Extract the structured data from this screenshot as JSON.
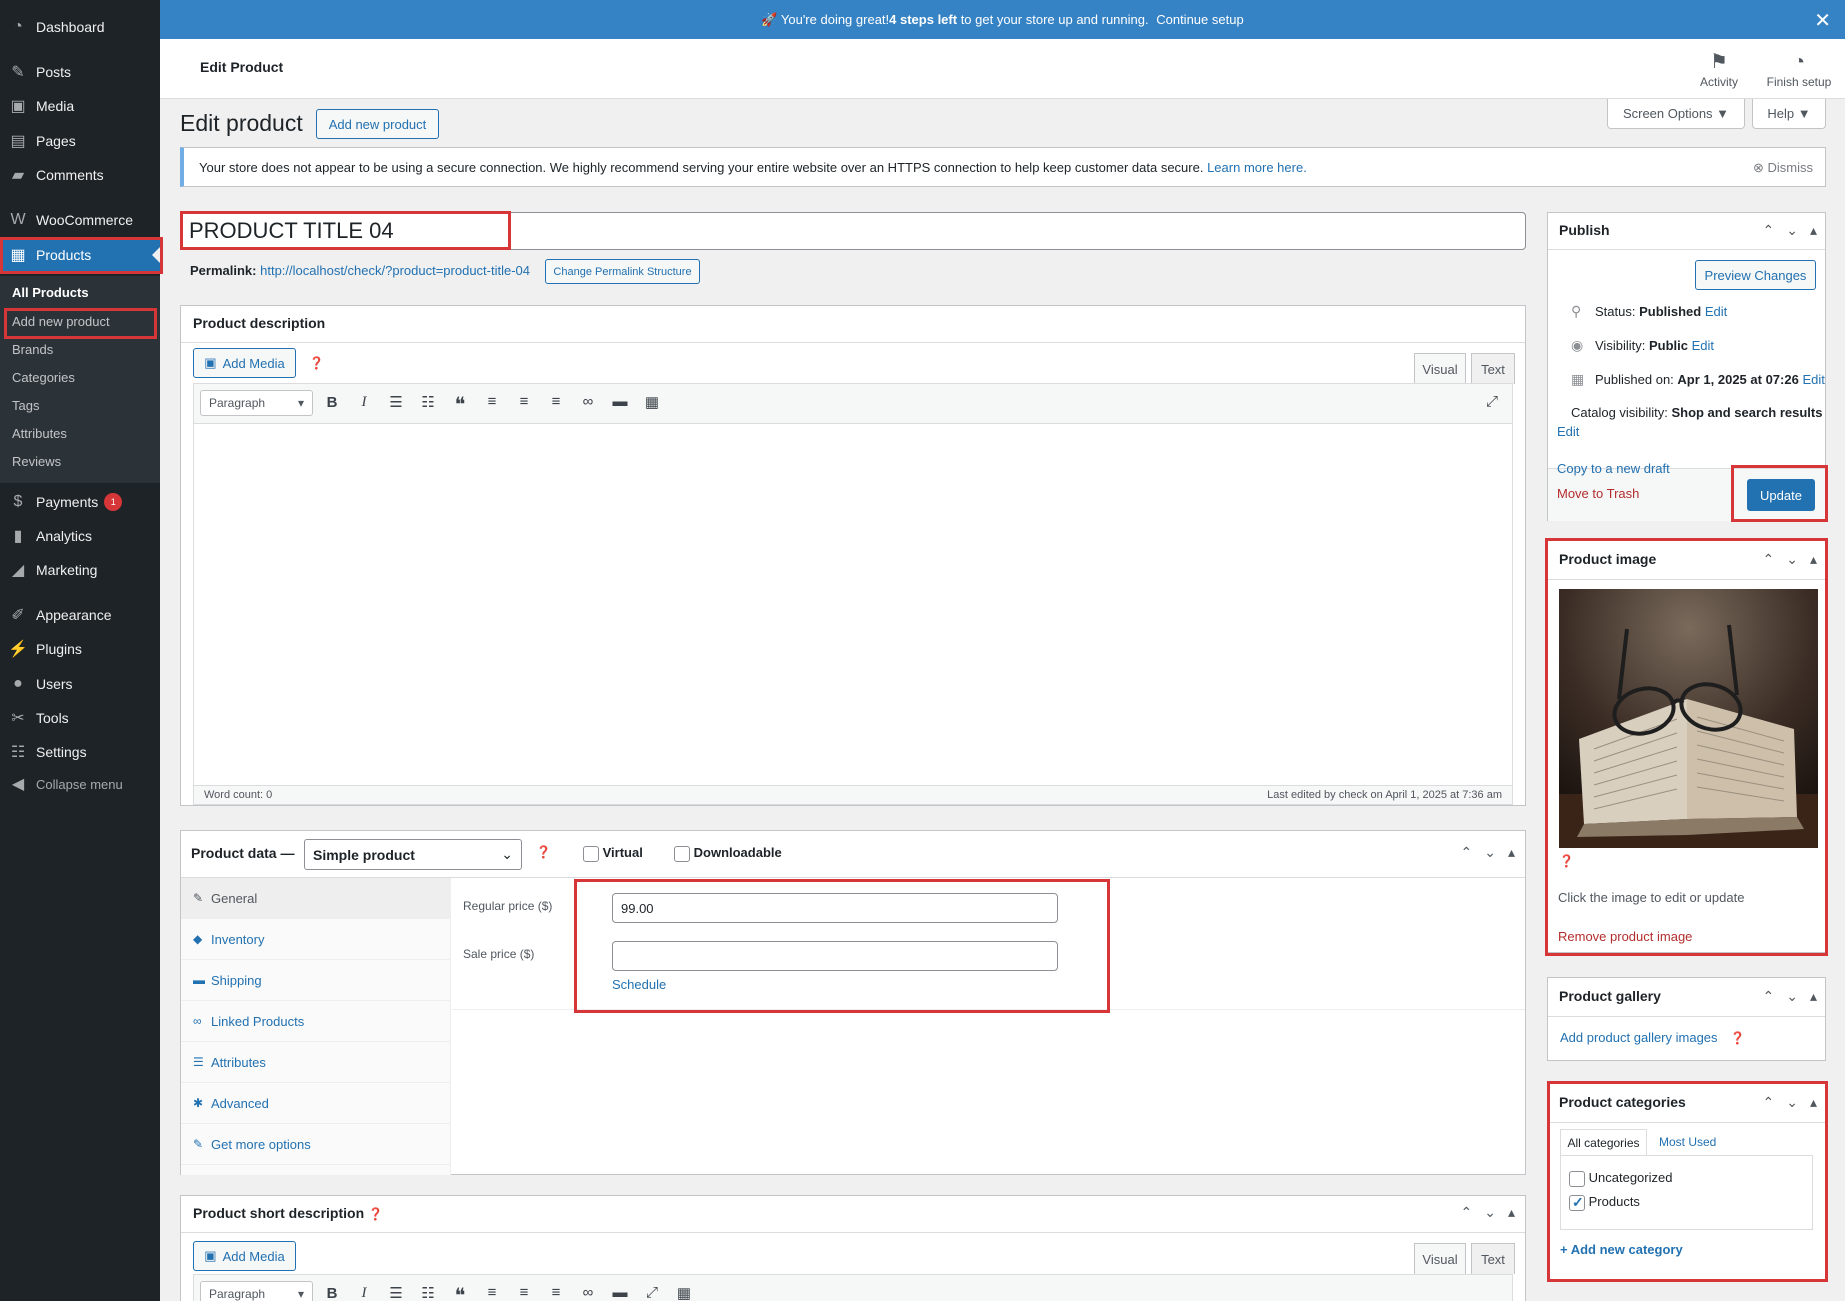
{
  "sidebar": {
    "items": [
      {
        "icon": "dashboard-icon",
        "glyph": "◔",
        "label": "Dashboard"
      },
      {
        "icon": "pin-icon",
        "glyph": "✎",
        "label": "Posts"
      },
      {
        "icon": "media-icon",
        "glyph": "▣",
        "label": "Media"
      },
      {
        "icon": "pages-icon",
        "glyph": "▤",
        "label": "Pages"
      },
      {
        "icon": "comments-icon",
        "glyph": "▰",
        "label": "Comments"
      },
      {
        "icon": "woocommerce-icon",
        "glyph": "W",
        "label": "WooCommerce"
      },
      {
        "icon": "products-icon",
        "glyph": "▦",
        "label": "Products"
      },
      {
        "icon": "payments-icon",
        "glyph": "$",
        "label": "Payments",
        "badge": "1"
      },
      {
        "icon": "analytics-icon",
        "glyph": "▮",
        "label": "Analytics"
      },
      {
        "icon": "marketing-icon",
        "glyph": "◢",
        "label": "Marketing"
      },
      {
        "icon": "appearance-icon",
        "glyph": "✐",
        "label": "Appearance"
      },
      {
        "icon": "plugins-icon",
        "glyph": "⚡",
        "label": "Plugins"
      },
      {
        "icon": "users-icon",
        "glyph": "●",
        "label": "Users"
      },
      {
        "icon": "tools-icon",
        "glyph": "✂",
        "label": "Tools"
      },
      {
        "icon": "settings-icon",
        "glyph": "☷",
        "label": "Settings"
      },
      {
        "icon": "collapse-icon",
        "glyph": "◀",
        "label": "Collapse menu"
      }
    ],
    "submenu": [
      "All Products",
      "Add new product",
      "Brands",
      "Categories",
      "Tags",
      "Attributes",
      "Reviews"
    ]
  },
  "banner": {
    "pre": "🚀 You're doing great! ",
    "bold": "4 steps left",
    "post": " to get your store up and running. ",
    "link": "Continue setup"
  },
  "header": {
    "title": "Edit Product",
    "activity": "Activity",
    "finish": "Finish setup"
  },
  "page": {
    "title": "Edit product",
    "add_new": "Add new product",
    "screen_options": "Screen Options ▼",
    "help": "Help ▼"
  },
  "notice": {
    "text": "Your store does not appear to be using a secure connection. We highly recommend serving your entire website over an HTTPS connection to help keep customer data secure.",
    "link": "Learn more here.",
    "dismiss": "Dismiss"
  },
  "product": {
    "title": "PRODUCT TITLE  04",
    "permalink_label": "Permalink:",
    "permalink_url": "http://localhost/check/?product=product-title-04",
    "change_permalink": "Change Permalink Structure"
  },
  "description": {
    "heading": "Product description",
    "add_media": "Add Media",
    "visual": "Visual",
    "text": "Text",
    "format": "Paragraph",
    "word_count": "Word count: 0",
    "last_edited": "Last edited by check on April 1, 2025 at 7:36 am"
  },
  "product_data": {
    "heading": "Product data —",
    "type": "Simple product",
    "virtual": "Virtual",
    "downloadable": "Downloadable",
    "tabs": [
      {
        "icon": "wrench-icon",
        "glyph": "✎",
        "label": "General"
      },
      {
        "icon": "tag-icon",
        "glyph": "◆",
        "label": "Inventory"
      },
      {
        "icon": "truck-icon",
        "glyph": "▬",
        "label": "Shipping"
      },
      {
        "icon": "link-icon",
        "glyph": "∞",
        "label": "Linked Products"
      },
      {
        "icon": "list-icon",
        "glyph": "☰",
        "label": "Attributes"
      },
      {
        "icon": "gear-icon",
        "glyph": "✱",
        "label": "Advanced"
      },
      {
        "icon": "plugin-icon",
        "glyph": "✎",
        "label": "Get more options"
      }
    ],
    "regular_price_label": "Regular price ($)",
    "regular_price": "99.00",
    "sale_price_label": "Sale price ($)",
    "sale_price": "",
    "schedule": "Schedule"
  },
  "short_description": {
    "heading": "Product short description",
    "add_media": "Add Media",
    "visual": "Visual",
    "text": "Text",
    "format": "Paragraph"
  },
  "publish": {
    "heading": "Publish",
    "preview": "Preview Changes",
    "status_label": "Status:",
    "status": "Published",
    "visibility_label": "Visibility:",
    "visibility": "Public",
    "published_label": "Published on:",
    "published": "Apr 1, 2025 at 07:26",
    "catalog_label": "Catalog visibility:",
    "catalog": "Shop and search results",
    "edit": "Edit",
    "copy_draft": "Copy to a new draft",
    "trash": "Move to Trash",
    "update": "Update"
  },
  "product_image": {
    "heading": "Product image",
    "hint": "Click the image to edit or update",
    "remove": "Remove product image"
  },
  "gallery": {
    "heading": "Product gallery",
    "add": "Add product gallery images"
  },
  "categories": {
    "heading": "Product categories",
    "tab_all": "All categories",
    "tab_used": "Most Used",
    "items": [
      {
        "label": "Uncategorized",
        "checked": false
      },
      {
        "label": "Products",
        "checked": true
      }
    ],
    "add": "+ Add new category"
  },
  "colors": {
    "accent": "#2271b1",
    "sidebar": "#1d2327",
    "banner": "#3582c4",
    "highlight": "#d63638"
  }
}
